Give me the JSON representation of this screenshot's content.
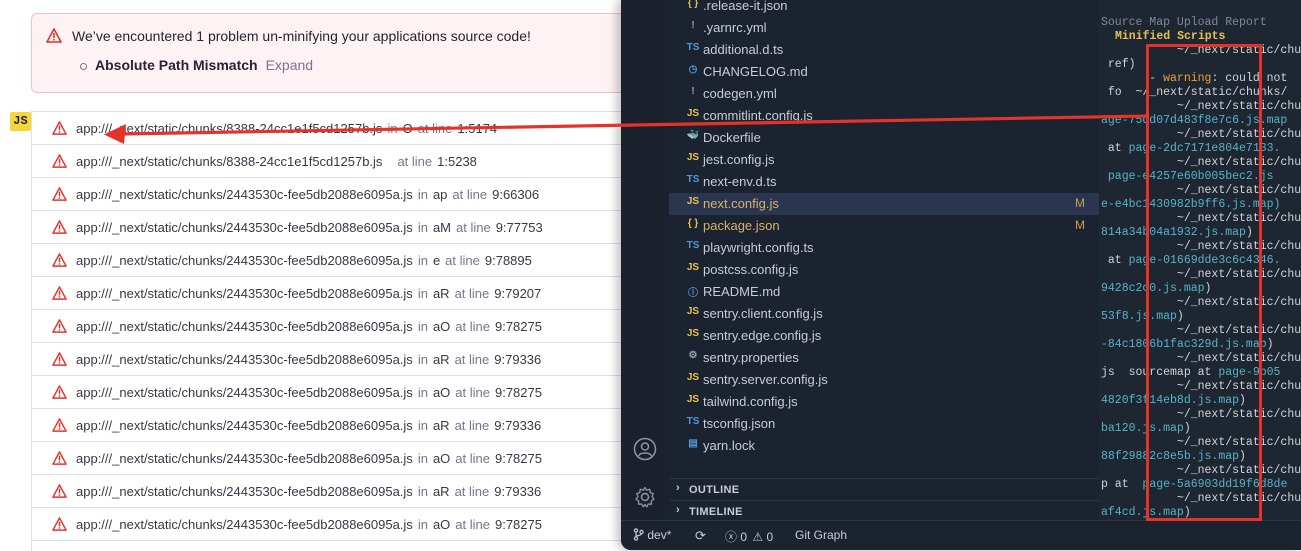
{
  "alert": {
    "title": "We’ve encountered 1 problem un-minifying your applications source code!",
    "problem": "Absolute Path Mismatch",
    "expand_label": "Expand"
  },
  "language_badge": "JS",
  "frames": [
    {
      "path": "app:///_next/static/chunks/8388-24cc1e1f5cd1257b.js",
      "in_label": "in",
      "func": "O",
      "at_label": "at line",
      "line": "1:5174"
    },
    {
      "path": "app:///_next/static/chunks/8388-24cc1e1f5cd1257b.js",
      "in_label": "",
      "func": "",
      "at_label": "at line",
      "line": "1:5238"
    },
    {
      "path": "app:///_next/static/chunks/2443530c-fee5db2088e6095a.js",
      "in_label": "in",
      "func": "ap",
      "at_label": "at line",
      "line": "9:66306"
    },
    {
      "path": "app:///_next/static/chunks/2443530c-fee5db2088e6095a.js",
      "in_label": "in",
      "func": "aM",
      "at_label": "at line",
      "line": "9:77753"
    },
    {
      "path": "app:///_next/static/chunks/2443530c-fee5db2088e6095a.js",
      "in_label": "in",
      "func": "e",
      "at_label": "at line",
      "line": "9:78895"
    },
    {
      "path": "app:///_next/static/chunks/2443530c-fee5db2088e6095a.js",
      "in_label": "in",
      "func": "aR",
      "at_label": "at line",
      "line": "9:79207"
    },
    {
      "path": "app:///_next/static/chunks/2443530c-fee5db2088e6095a.js",
      "in_label": "in",
      "func": "aO",
      "at_label": "at line",
      "line": "9:78275"
    },
    {
      "path": "app:///_next/static/chunks/2443530c-fee5db2088e6095a.js",
      "in_label": "in",
      "func": "aR",
      "at_label": "at line",
      "line": "9:79336"
    },
    {
      "path": "app:///_next/static/chunks/2443530c-fee5db2088e6095a.js",
      "in_label": "in",
      "func": "aO",
      "at_label": "at line",
      "line": "9:78275"
    },
    {
      "path": "app:///_next/static/chunks/2443530c-fee5db2088e6095a.js",
      "in_label": "in",
      "func": "aR",
      "at_label": "at line",
      "line": "9:79336"
    },
    {
      "path": "app:///_next/static/chunks/2443530c-fee5db2088e6095a.js",
      "in_label": "in",
      "func": "aO",
      "at_label": "at line",
      "line": "9:78275"
    },
    {
      "path": "app:///_next/static/chunks/2443530c-fee5db2088e6095a.js",
      "in_label": "in",
      "func": "aR",
      "at_label": "at line",
      "line": "9:79336"
    },
    {
      "path": "app:///_next/static/chunks/2443530c-fee5db2088e6095a.js",
      "in_label": "in",
      "func": "aO",
      "at_label": "at line",
      "line": "9:78275"
    }
  ],
  "explorer": {
    "files": [
      {
        "icon": "{ }",
        "icon_color": "#e6c152",
        "name": ".release-it.json",
        "status": ""
      },
      {
        "icon": "!",
        "icon_color": "#c586c0",
        "name": ".yarnrc.yml",
        "status": ""
      },
      {
        "icon": "TS",
        "icon_color": "#4e9ad8",
        "name": "additional.d.ts",
        "status": ""
      },
      {
        "icon": "◷",
        "icon_color": "#4e9ad8",
        "name": "CHANGELOG.md",
        "status": ""
      },
      {
        "icon": "!",
        "icon_color": "#c586c0",
        "name": "codegen.yml",
        "status": ""
      },
      {
        "icon": "JS",
        "icon_color": "#e6c152",
        "name": "commitlint.config.js",
        "status": ""
      },
      {
        "icon": "🐳",
        "icon_color": "#4e9ad8",
        "name": "Dockerfile",
        "status": ""
      },
      {
        "icon": "JS",
        "icon_color": "#e6c152",
        "name": "jest.config.js",
        "status": ""
      },
      {
        "icon": "TS",
        "icon_color": "#4e9ad8",
        "name": "next-env.d.ts",
        "status": ""
      },
      {
        "icon": "JS",
        "icon_color": "#e6c152",
        "name": "next.config.js",
        "status": "M"
      },
      {
        "icon": "{ }",
        "icon_color": "#e6c152",
        "name": "package.json",
        "status": "M"
      },
      {
        "icon": "TS",
        "icon_color": "#4e9ad8",
        "name": "playwright.config.ts",
        "status": ""
      },
      {
        "icon": "JS",
        "icon_color": "#e6c152",
        "name": "postcss.config.js",
        "status": ""
      },
      {
        "icon": "ⓘ",
        "icon_color": "#4e9ad8",
        "name": "README.md",
        "status": ""
      },
      {
        "icon": "JS",
        "icon_color": "#e6c152",
        "name": "sentry.client.config.js",
        "status": ""
      },
      {
        "icon": "JS",
        "icon_color": "#e6c152",
        "name": "sentry.edge.config.js",
        "status": ""
      },
      {
        "icon": "⚙",
        "icon_color": "#9aa2ad",
        "name": "sentry.properties",
        "status": ""
      },
      {
        "icon": "JS",
        "icon_color": "#e6c152",
        "name": "sentry.server.config.js",
        "status": ""
      },
      {
        "icon": "JS",
        "icon_color": "#e6c152",
        "name": "tailwind.config.js",
        "status": ""
      },
      {
        "icon": "TS",
        "icon_color": "#4e9ad8",
        "name": "tsconfig.json",
        "status": ""
      },
      {
        "icon": "▤",
        "icon_color": "#4e9ad8",
        "name": "yarn.lock",
        "status": ""
      }
    ],
    "outline_label": "OUTLINE",
    "timeline_label": "TIMELINE"
  },
  "statusbar": {
    "branch": "dev*",
    "errors": "0",
    "warnings": "0",
    "git_graph": "Git Graph"
  },
  "terminal": {
    "header": "Source Map Upload Report",
    "subheader": "Minified Scripts",
    "lines": [
      [
        {
          "t": "           ~/_next/static/chunks/",
          "c": ""
        }
      ],
      [
        {
          "t": " ref)",
          "c": ""
        }
      ],
      [
        {
          "t": "       - ",
          "c": ""
        },
        {
          "t": "warning",
          "c": "og"
        },
        {
          "t": ": could not",
          "c": ""
        }
      ],
      [
        {
          "t": " fo",
          "c": ""
        },
        {
          "t": "  ~/_next/static/chunks/",
          "c": ""
        }
      ],
      [
        {
          "t": "           ~/_next/static/chunks/",
          "c": ""
        }
      ],
      [
        {
          "t": "age-75dd07d483f8e7c6.js.map",
          "c": "cy"
        }
      ],
      [
        {
          "t": "           ~/_next/static/chunks/",
          "c": ""
        }
      ],
      [
        {
          "t": " at ",
          "c": ""
        },
        {
          "t": "page-2dc7171e804e7133.",
          "c": "cy"
        }
      ],
      [
        {
          "t": "           ~/_next/static/chunks/",
          "c": ""
        }
      ],
      [
        {
          "t": " page-e4257e60b005bec2.js",
          "c": "cy"
        }
      ],
      [
        {
          "t": "           ~/_next/static/chunks/",
          "c": ""
        }
      ],
      [
        {
          "t": "e-e4bc1430982b9ff6.js.map)",
          "c": "cy"
        }
      ],
      [
        {
          "t": "           ~/_next/static/chunks/",
          "c": ""
        }
      ],
      [
        {
          "t": "814a34b04a1932.js.map",
          "c": "cy"
        },
        {
          "t": ")",
          "c": ""
        }
      ],
      [
        {
          "t": "           ~/_next/static/chunks/",
          "c": ""
        }
      ],
      [
        {
          "t": " at ",
          "c": ""
        },
        {
          "t": "page-01669dde3c6c4346.",
          "c": "cy"
        }
      ],
      [
        {
          "t": "           ~/_next/static/chunks/",
          "c": ""
        }
      ],
      [
        {
          "t": "9428c2c0.js.map",
          "c": "cy"
        },
        {
          "t": ")",
          "c": ""
        }
      ],
      [
        {
          "t": "           ~/_next/static/chunks/",
          "c": ""
        }
      ],
      [
        {
          "t": "53f8.js.map",
          "c": "cy"
        },
        {
          "t": ")",
          "c": ""
        }
      ],
      [
        {
          "t": "           ~/_next/static/chunks/",
          "c": ""
        }
      ],
      [
        {
          "t": "-84c1806b1fac329d.js.map",
          "c": "cy"
        },
        {
          "t": ")",
          "c": ""
        }
      ],
      [
        {
          "t": "           ~/_next/static/chunks/",
          "c": ""
        }
      ],
      [
        {
          "t": "js  sourcemap at ",
          "c": ""
        },
        {
          "t": "page-9b05",
          "c": "cy"
        }
      ],
      [
        {
          "t": "           ~/_next/static/chunks/",
          "c": ""
        }
      ],
      [
        {
          "t": "4820f3f14eb8d.js.map",
          "c": "cy"
        },
        {
          "t": ")",
          "c": ""
        }
      ],
      [
        {
          "t": "           ~/_next/static/chunks/",
          "c": ""
        }
      ],
      [
        {
          "t": "ba120.js.map",
          "c": "cy"
        },
        {
          "t": ")",
          "c": ""
        }
      ],
      [
        {
          "t": "           ~/_next/static/chunks/",
          "c": ""
        }
      ],
      [
        {
          "t": "88f29882c8e5b.js.map",
          "c": "cy"
        },
        {
          "t": ")",
          "c": ""
        }
      ],
      [
        {
          "t": "           ~/_next/static/chunks/",
          "c": ""
        }
      ],
      [
        {
          "t": "p at  ",
          "c": ""
        },
        {
          "t": "page-5a6903dd19f6d8de",
          "c": "cy"
        }
      ],
      [
        {
          "t": "           ~/_next/static/chunks/",
          "c": ""
        }
      ],
      [
        {
          "t": "af4cd.js.map",
          "c": "cy"
        },
        {
          "t": ")",
          "c": ""
        }
      ]
    ]
  },
  "colors": {
    "annotation_red": "#e5332a",
    "alert_bg": "#fdf3f4",
    "vscode_bg": "#1e2632"
  }
}
